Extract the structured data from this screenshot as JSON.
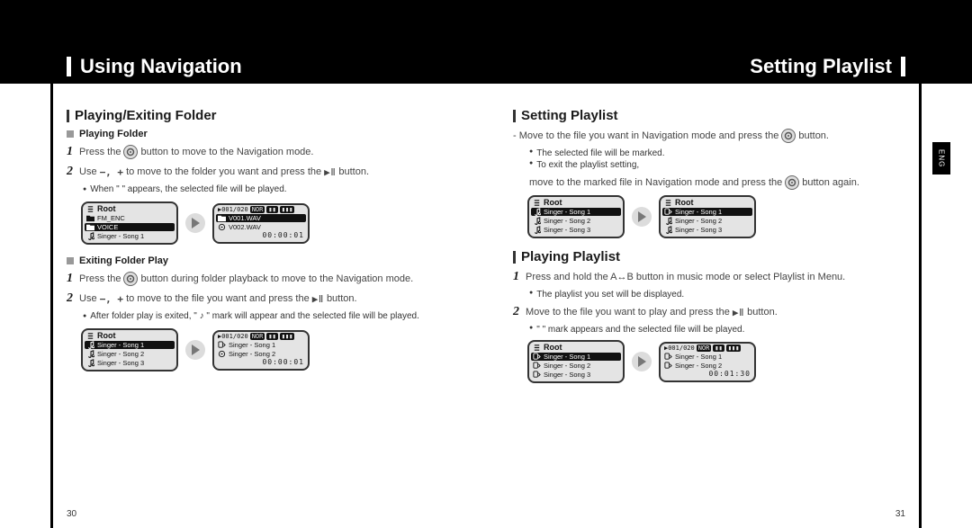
{
  "header": {
    "left": "Using Navigation",
    "right": "Setting Playlist"
  },
  "tab": "ENG",
  "page_left": "30",
  "page_right": "31",
  "left": {
    "h1": "Playing/Exiting Folder",
    "playing_folder": {
      "title": "Playing Folder",
      "step1_a": "Press the",
      "step1_b": "button to move to the Navigation mode.",
      "step2_a": "Use",
      "step2_pm": "−, +",
      "step2_b": "to move to the folder you want and press the",
      "step2_c": "button.",
      "note": "When \"       \" appears, the selected file will be played.",
      "lcd1": {
        "title": "Root",
        "rows": [
          {
            "icon": "folder",
            "label": "FM_ENC",
            "sel": false
          },
          {
            "icon": "folder",
            "label": "VOICE",
            "sel": true
          },
          {
            "icon": "note",
            "label": "Singer - Song 1",
            "sel": false
          }
        ]
      },
      "lcd2": {
        "status": "001/020",
        "badges": [
          "NOR"
        ],
        "rows": [
          {
            "icon": "folder",
            "label": "V001.WAV",
            "sel": true
          },
          {
            "icon": "file",
            "label": "V002.WAV",
            "sel": false
          }
        ],
        "time": "00:00:01"
      }
    },
    "exiting": {
      "title": "Exiting Folder Play",
      "step1_a": "Press the",
      "step1_b": "button during folder playback to move to the Navigation mode.",
      "step2_a": "Use",
      "step2_pm": "−, +",
      "step2_b": "to move to the file you want and press the",
      "step2_c": "button.",
      "note": "After folder play is exited, \" ♪ \" mark will appear and the selected file will be played.",
      "lcd1": {
        "title": "Root",
        "rows": [
          {
            "icon": "note",
            "label": "Singer - Song 1",
            "sel": true
          },
          {
            "icon": "note",
            "label": "Singer - Song 2",
            "sel": false
          },
          {
            "icon": "note",
            "label": "Singer - Song 3",
            "sel": false
          }
        ]
      },
      "lcd2": {
        "status": "001/020",
        "badges": [
          "NOR"
        ],
        "rows": [
          {
            "icon": "playlist",
            "label": "Singer - Song 1",
            "sel": false
          },
          {
            "icon": "file",
            "label": "Singer - Song 2",
            "sel": false
          }
        ],
        "time": "00:00:01"
      }
    }
  },
  "right": {
    "setting": {
      "h1": "Setting Playlist",
      "line1_a": "- Move to the file you want in Navigation mode and press the",
      "line1_b": "button.",
      "b1": "The selected file will be marked.",
      "b2": "To exit the playlist setting,",
      "b2b": "move to the marked file in Navigation mode and press the",
      "b2c": "button again.",
      "lcd1": {
        "title": "Root",
        "rows": [
          {
            "icon": "note",
            "label": "Singer - Song 1",
            "sel": true
          },
          {
            "icon": "note",
            "label": "Singer - Song 2",
            "sel": false
          },
          {
            "icon": "note",
            "label": "Singer - Song 3",
            "sel": false
          }
        ]
      },
      "lcd2": {
        "title": "Root",
        "rows": [
          {
            "icon": "playlist",
            "label": "Singer - Song 1",
            "sel": true
          },
          {
            "icon": "note",
            "label": "Singer - Song 2",
            "sel": false
          },
          {
            "icon": "note",
            "label": "Singer - Song 3",
            "sel": false
          }
        ]
      }
    },
    "playing": {
      "h1": "Playing Playlist",
      "step1_a": "Press and hold the A↔B button in music mode or select Playlist in Menu.",
      "b1": "The playlist you set will be displayed.",
      "step2_a": "Move to the file you want to play and press the",
      "step2_b": "button.",
      "b2": "\"     \" mark appears and the selected file will be played.",
      "lcd1": {
        "title": "Root",
        "rows": [
          {
            "icon": "playlist",
            "label": "Singer - Song 1",
            "sel": true
          },
          {
            "icon": "playlist",
            "label": "Singer - Song 2",
            "sel": false
          },
          {
            "icon": "playlist",
            "label": "Singer - Song 3",
            "sel": false
          }
        ]
      },
      "lcd2": {
        "status": "001/020",
        "badges": [
          "NOR"
        ],
        "rows": [
          {
            "icon": "playlist",
            "label": "Singer - Song 1",
            "sel": false
          },
          {
            "icon": "playlist",
            "label": "Singer - Song 2",
            "sel": false
          }
        ],
        "time": "00:01:30"
      }
    }
  }
}
